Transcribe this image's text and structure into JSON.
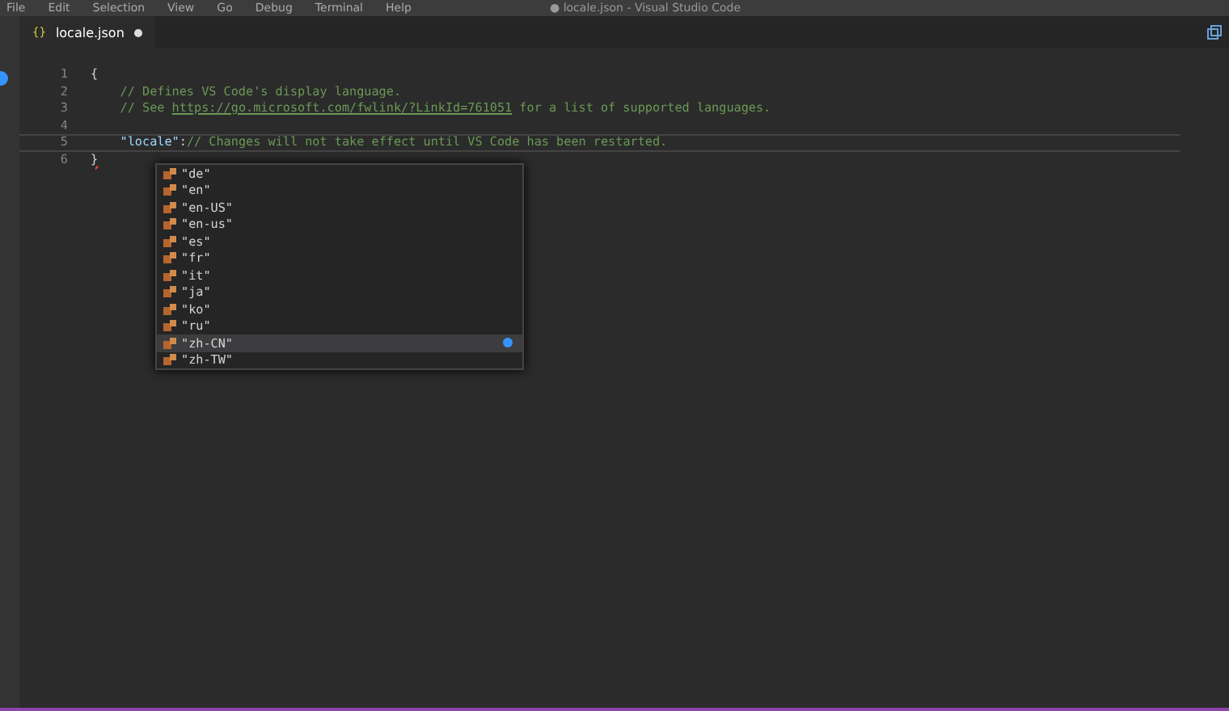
{
  "menu": [
    "File",
    "Edit",
    "Selection",
    "View",
    "Go",
    "Debug",
    "Terminal",
    "Help"
  ],
  "window": {
    "title": "● locale.json - Visual Studio Code"
  },
  "tabs": [
    {
      "icon": "{}",
      "label": "locale.json",
      "selected": true,
      "modified": true
    }
  ],
  "editor": {
    "lines": [
      {
        "number": "1",
        "parts": [
          {
            "kind": "punct",
            "text": "{"
          }
        ]
      },
      {
        "number": "2",
        "parts": [
          {
            "kind": "comment",
            "text": "    // Defines VS Code's display language."
          }
        ]
      },
      {
        "number": "3",
        "parts": [
          {
            "kind": "comment",
            "text": "    // See "
          },
          {
            "kind": "link",
            "text": "https://go.microsoft.com/fwlink/?LinkId=761051"
          },
          {
            "kind": "comment",
            "text": " for a list of supported languages."
          }
        ]
      },
      {
        "number": "4"
      },
      {
        "number": "5",
        "parts": [
          {
            "kind": "key",
            "text": "    \"locale\""
          },
          {
            "kind": "punct",
            "text": ":"
          },
          {
            "kind": "comment",
            "text": "// Changes will not take effect until VS Code has been restarted."
          }
        ]
      },
      {
        "number": "6",
        "parts": [
          {
            "kind": "error",
            "text": "}"
          }
        ]
      }
    ]
  },
  "suggestions": [
    {
      "label": "\"de\"",
      "selected": false
    },
    {
      "label": "\"en\"",
      "selected": false
    },
    {
      "label": "\"en-US\"",
      "selected": false
    },
    {
      "label": "\"en-us\"",
      "selected": false
    },
    {
      "label": "\"es\"",
      "selected": false
    },
    {
      "label": "\"fr\"",
      "selected": false
    },
    {
      "label": "\"it\"",
      "selected": false
    },
    {
      "label": "\"ja\"",
      "selected": false
    },
    {
      "label": "\"ko\"",
      "selected": false
    },
    {
      "label": "\"ru\"",
      "selected": false
    },
    {
      "label": "\"zh-CN\"",
      "selected": true
    },
    {
      "label": "\"zh-TW\"",
      "selected": false
    }
  ]
}
